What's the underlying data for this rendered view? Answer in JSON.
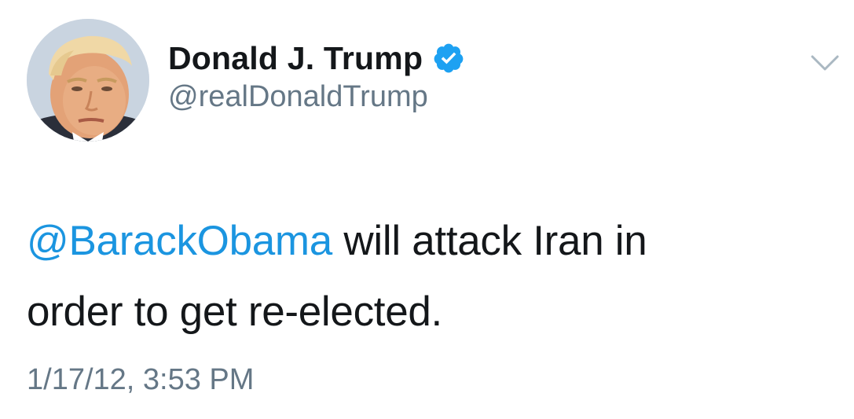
{
  "tweet": {
    "author": {
      "display_name": "Donald J. Trump",
      "handle": "@realDonaldTrump",
      "verified": true,
      "avatar_icon": "profile-photo"
    },
    "body": {
      "mention": "@BarackObama",
      "text_line1": " will attack Iran in",
      "text_line2": "order to get re-elected."
    },
    "timestamp": "1/17/12, 3:53 PM",
    "menu_icon": "chevron-down-icon"
  },
  "colors": {
    "text": "#14171a",
    "secondary": "#657786",
    "link": "#1b95e0",
    "verified_badge": "#1da1f2",
    "chevron": "#aab8c2"
  }
}
